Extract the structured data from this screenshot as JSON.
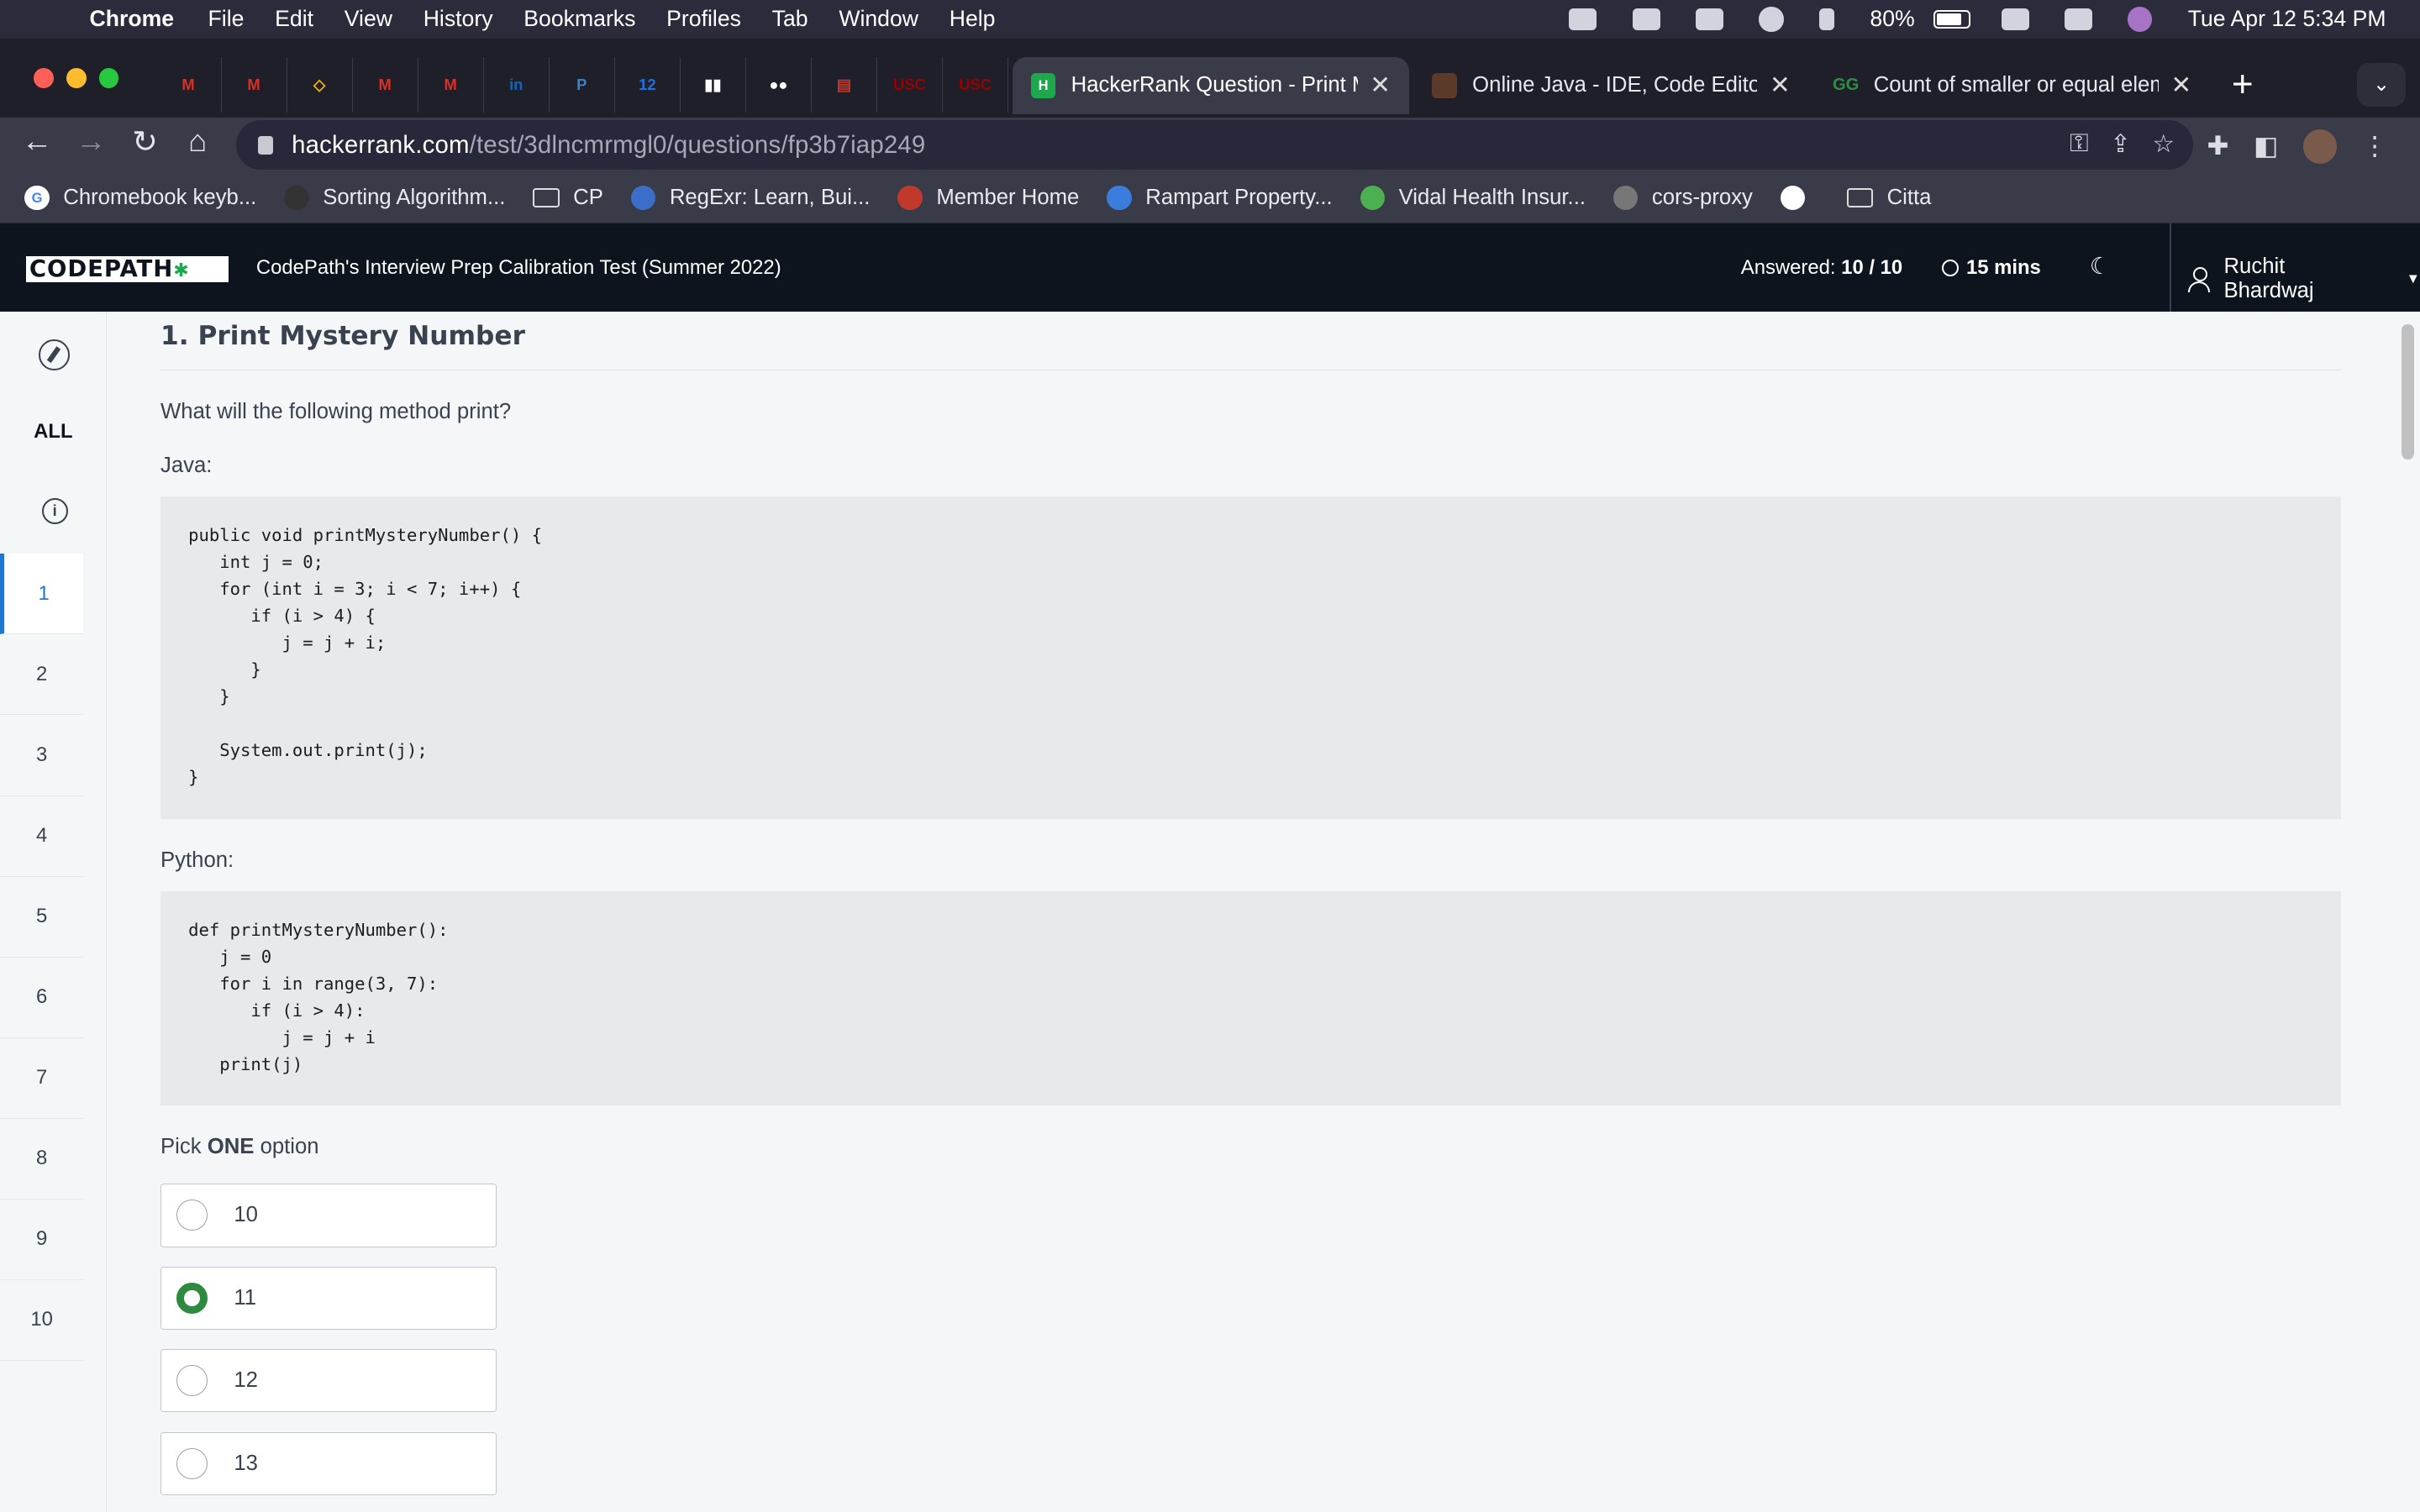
{
  "menubar": {
    "app": "Chrome",
    "items": [
      "File",
      "Edit",
      "View",
      "History",
      "Bookmarks",
      "Profiles",
      "Tab",
      "Window",
      "Help"
    ],
    "battery": "80%",
    "datetime": "Tue Apr 12  5:34 PM"
  },
  "tabs": {
    "pinned": [
      {
        "icon": "gmail-icon",
        "glyph": "M",
        "color": "#d93025"
      },
      {
        "icon": "gmail-icon",
        "glyph": "M",
        "color": "#d93025"
      },
      {
        "icon": "diamond-icon",
        "glyph": "◇",
        "color": "#f4b400"
      },
      {
        "icon": "gmail-icon",
        "glyph": "M",
        "color": "#d93025"
      },
      {
        "icon": "gmail-icon",
        "glyph": "M",
        "color": "#d93025"
      },
      {
        "icon": "linkedin-icon",
        "glyph": "in",
        "color": "#0a66c2"
      },
      {
        "icon": "p-icon",
        "glyph": "P",
        "color": "#3b82c4"
      },
      {
        "icon": "calendar-icon",
        "glyph": "12",
        "color": "#1a73e8"
      },
      {
        "icon": "trello-icon",
        "glyph": "▮▮",
        "color": "#ffffff"
      },
      {
        "icon": "medium-icon",
        "glyph": "●●",
        "color": "#ffffff"
      },
      {
        "icon": "book-icon",
        "glyph": "▤",
        "color": "#c0392b"
      },
      {
        "icon": "usc-icon",
        "glyph": "USC",
        "color": "#990000"
      },
      {
        "icon": "usc-icon",
        "glyph": "USC",
        "color": "#990000"
      }
    ],
    "open": [
      {
        "title": "HackerRank Question - Print M",
        "active": true
      },
      {
        "title": "Online Java - IDE, Code Editor,",
        "active": false
      },
      {
        "title": "Count of smaller or equal elem",
        "active": false
      }
    ]
  },
  "toolbar": {
    "url_host": "hackerrank.com",
    "url_path": "/test/3dlncmrmgl0/questions/fp3b7iap249"
  },
  "bookmarks": [
    {
      "label": "Chromebook keyb...",
      "type": "google"
    },
    {
      "label": "Sorting Algorithm...",
      "type": "site"
    },
    {
      "label": "CP",
      "type": "folder"
    },
    {
      "label": "RegExr: Learn, Bui...",
      "type": "site"
    },
    {
      "label": "Member Home",
      "type": "site"
    },
    {
      "label": "Rampart Property...",
      "type": "site"
    },
    {
      "label": "Vidal Health Insur...",
      "type": "site"
    },
    {
      "label": "cors-proxy",
      "type": "site"
    },
    {
      "label": "",
      "type": "site"
    },
    {
      "label": "Citta",
      "type": "folder"
    }
  ],
  "header": {
    "logo": "CODEPATH",
    "test_name": "CodePath's Interview Prep Calibration Test (Summer 2022)",
    "answered_label": "Answered:",
    "answered_value": "10 / 10",
    "time": "15 mins",
    "user": "Ruchit Bhardwaj"
  },
  "sidenav": {
    "all_label": "ALL",
    "questions": [
      "1",
      "2",
      "3",
      "4",
      "5",
      "6",
      "7",
      "8",
      "9",
      "10"
    ],
    "active": "1"
  },
  "question": {
    "title": "1. Print Mystery Number",
    "prompt": "What will the following method print?",
    "java_label": "Java:",
    "java_code": "public void printMysteryNumber() {\n   int j = 0;\n   for (int i = 3; i < 7; i++) {\n      if (i > 4) {\n         j = j + i;\n      }\n   }\n\n   System.out.print(j);\n}",
    "python_label": "Python:",
    "python_code": "def printMysteryNumber():\n   j = 0\n   for i in range(3, 7):\n      if (i > 4):\n         j = j + i\n   print(j)",
    "pick_prefix": "Pick ",
    "pick_bold": "ONE",
    "pick_suffix": " option",
    "options": [
      "10",
      "11",
      "12",
      "13"
    ],
    "selected": "11"
  }
}
